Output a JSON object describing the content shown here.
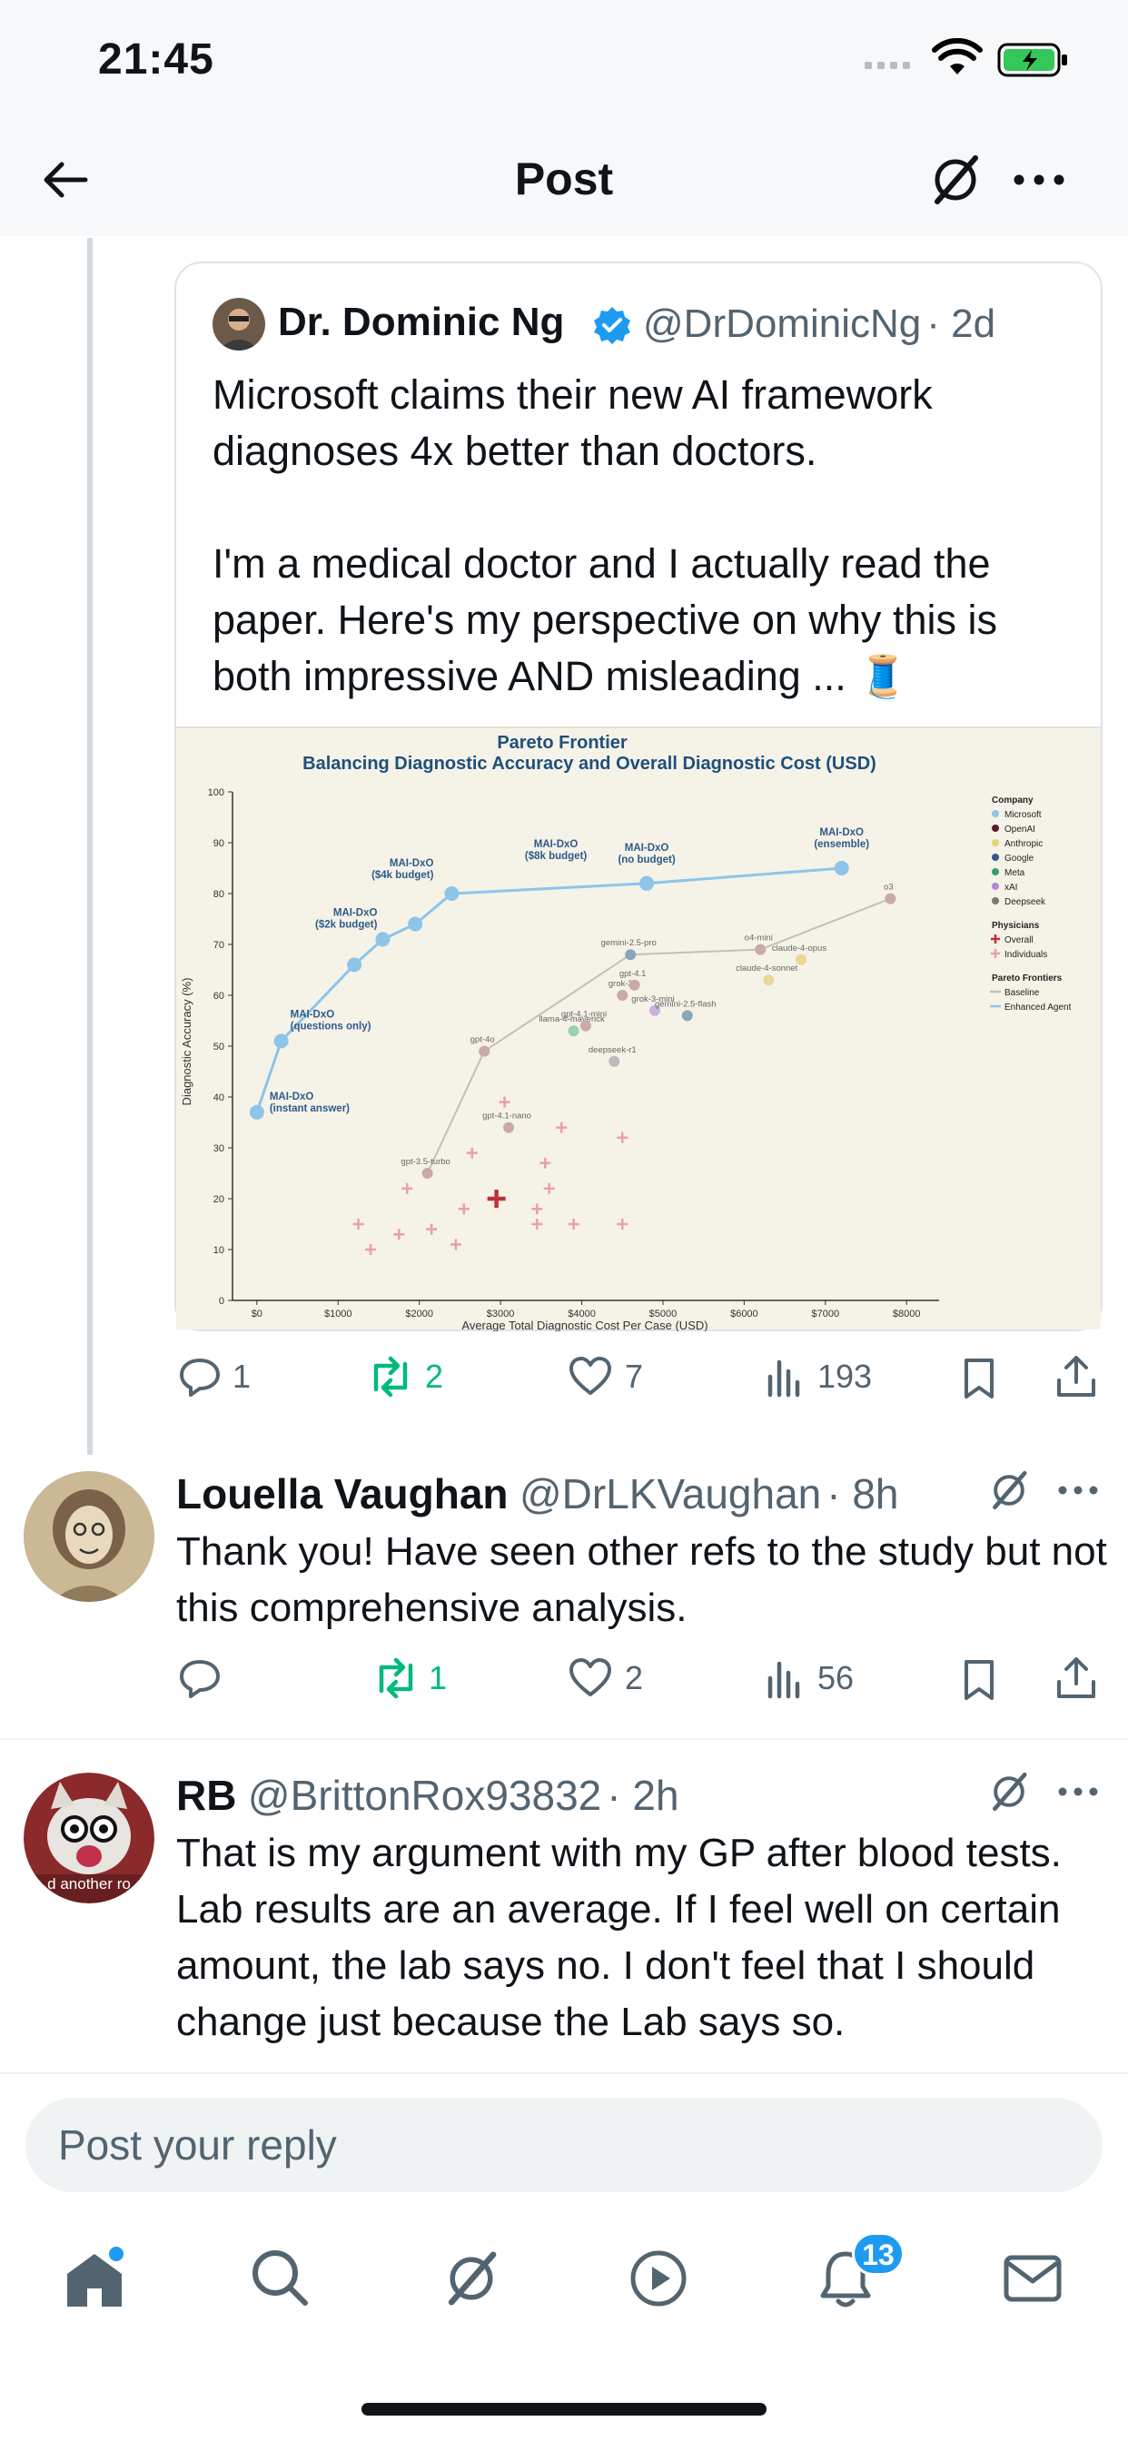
{
  "status_bar": {
    "time": "21:45"
  },
  "header": {
    "title": "Post"
  },
  "quoted_post": {
    "author_name": "Dr. Dominic Ng",
    "author_handle": "@DrDominicNg",
    "age": "· 2d",
    "text": "Microsoft claims their new AI framework diagnoses 4x better than doctors.\n\nI'm a medical doctor and I actually read the paper. Here's my perspective on why this is both impressive AND misleading ...",
    "thread_emoji": "🧵",
    "stats": {
      "replies": "1",
      "reposts": "2",
      "likes": "7",
      "views": "193"
    }
  },
  "chart_data": {
    "type": "scatter",
    "title": "Pareto Frontier",
    "subtitle": "Balancing Diagnostic Accuracy and Overall Diagnostic Cost (USD)",
    "xlabel": "Average Total Diagnostic Cost Per Case (USD)",
    "ylabel": "Diagnostic Accuracy (%)",
    "xlim": [
      -300,
      8400
    ],
    "ylim": [
      0,
      100
    ],
    "x_ticks": [
      "$0",
      "$1000",
      "$2000",
      "$3000",
      "$4000",
      "$5000",
      "$6000",
      "$7000",
      "$8000"
    ],
    "y_ticks": [
      "0",
      "10",
      "20",
      "30",
      "40",
      "50",
      "60",
      "70",
      "80",
      "90",
      "100"
    ],
    "enhanced_agent": [
      {
        "label": "MAI-DxO\n(instant answer)",
        "x": 0,
        "y": 37
      },
      {
        "label": "MAI-DxO\n(questions only)",
        "x": 300,
        "y": 51
      },
      {
        "label": "",
        "x": 1200,
        "y": 66
      },
      {
        "label": "MAI-DxO\n($2k budget)",
        "x": 1550,
        "y": 71
      },
      {
        "label": "",
        "x": 1950,
        "y": 74
      },
      {
        "label": "MAI-DxO\n($4k budget)",
        "x": 2400,
        "y": 80
      },
      {
        "label": "MAI-DxO\n($8k budget)",
        "x": 4800,
        "y": 82
      },
      {
        "label": "MAI-DxO\n(no budget)",
        "x": 4800,
        "y": 82
      },
      {
        "label": "MAI-DxO\n(ensemble)",
        "x": 7200,
        "y": 85
      }
    ],
    "baseline": [
      {
        "label": "gpt-3.5-turbo",
        "x": 2100,
        "y": 25
      },
      {
        "label": "gpt-4o",
        "x": 2800,
        "y": 49
      },
      {
        "label": "gpt-4.1-nano",
        "x": 3100,
        "y": 34
      },
      {
        "label": "llama-4-maverick",
        "x": 3900,
        "y": 53
      },
      {
        "label": "gpt-4.1-mini",
        "x": 4050,
        "y": 54
      },
      {
        "label": "deepseek-r1",
        "x": 4400,
        "y": 47
      },
      {
        "label": "grok-3",
        "x": 4500,
        "y": 60
      },
      {
        "label": "gpt-4.1",
        "x": 4650,
        "y": 62
      },
      {
        "label": "grok-3-mini",
        "x": 4900,
        "y": 57
      },
      {
        "label": "gemini-2.5-pro",
        "x": 4600,
        "y": 68
      },
      {
        "label": "gemini-2.5-flash",
        "x": 5300,
        "y": 56
      },
      {
        "label": "o4-mini",
        "x": 6200,
        "y": 69
      },
      {
        "label": "claude-4-opus",
        "x": 6700,
        "y": 67
      },
      {
        "label": "claude-4-sonnet",
        "x": 6300,
        "y": 63
      },
      {
        "label": "o3",
        "x": 7800,
        "y": 79
      }
    ],
    "physicians_individual": [
      [
        1250,
        15
      ],
      [
        1400,
        10
      ],
      [
        1750,
        13
      ],
      [
        1850,
        22
      ],
      [
        2150,
        14
      ],
      [
        2450,
        11
      ],
      [
        2550,
        18
      ],
      [
        2650,
        29
      ],
      [
        3050,
        39
      ],
      [
        3450,
        18
      ],
      [
        3450,
        15
      ],
      [
        3600,
        22
      ],
      [
        3550,
        27
      ],
      [
        3750,
        34
      ],
      [
        3900,
        15
      ],
      [
        4500,
        15
      ],
      [
        4500,
        32
      ]
    ],
    "physicians_overall": {
      "x": 2950,
      "y": 20
    },
    "legend": {
      "company_title": "Company",
      "companies": [
        {
          "name": "Microsoft",
          "color": "#8ec4e8"
        },
        {
          "name": "OpenAI",
          "color": "#5a1a2a"
        },
        {
          "name": "Anthropic",
          "color": "#e8d27a"
        },
        {
          "name": "Google",
          "color": "#2f5a8a"
        },
        {
          "name": "Meta",
          "color": "#3a9a7a"
        },
        {
          "name": "xAI",
          "color": "#b28ad0"
        },
        {
          "name": "Deepseek",
          "color": "#777777"
        }
      ],
      "physicians_title": "Physicians",
      "physicians": [
        {
          "name": "Overall",
          "color": "#c0303a"
        },
        {
          "name": "Individuals",
          "color": "#e8a0a8"
        }
      ],
      "frontier_title": "Pareto Frontiers",
      "frontiers": [
        {
          "name": "Baseline",
          "color": "#c9bdb5"
        },
        {
          "name": "Enhanced Agent",
          "color": "#8ec4e8"
        }
      ]
    }
  },
  "replies": [
    {
      "name": "Louella Vaughan",
      "handle": "@DrLKVaughan",
      "age": "· 8h",
      "text": "Thank you! Have seen other refs to the study but not this comprehensive analysis.",
      "stats": {
        "replies": "",
        "reposts": "1",
        "likes": "2",
        "views": "56"
      }
    },
    {
      "name": "RB",
      "handle": "@BrittonRox93832",
      "age": "· 2h",
      "text": "That is my argument with my GP after blood tests. Lab results are an average. If I feel well on certain amount, the lab says no. I don't feel that I should change just because the Lab says so.",
      "avatar_caption": "d another ro"
    }
  ],
  "reply_box": {
    "placeholder": "Post your reply"
  },
  "tab_bar": {
    "notifications_badge": "13"
  }
}
